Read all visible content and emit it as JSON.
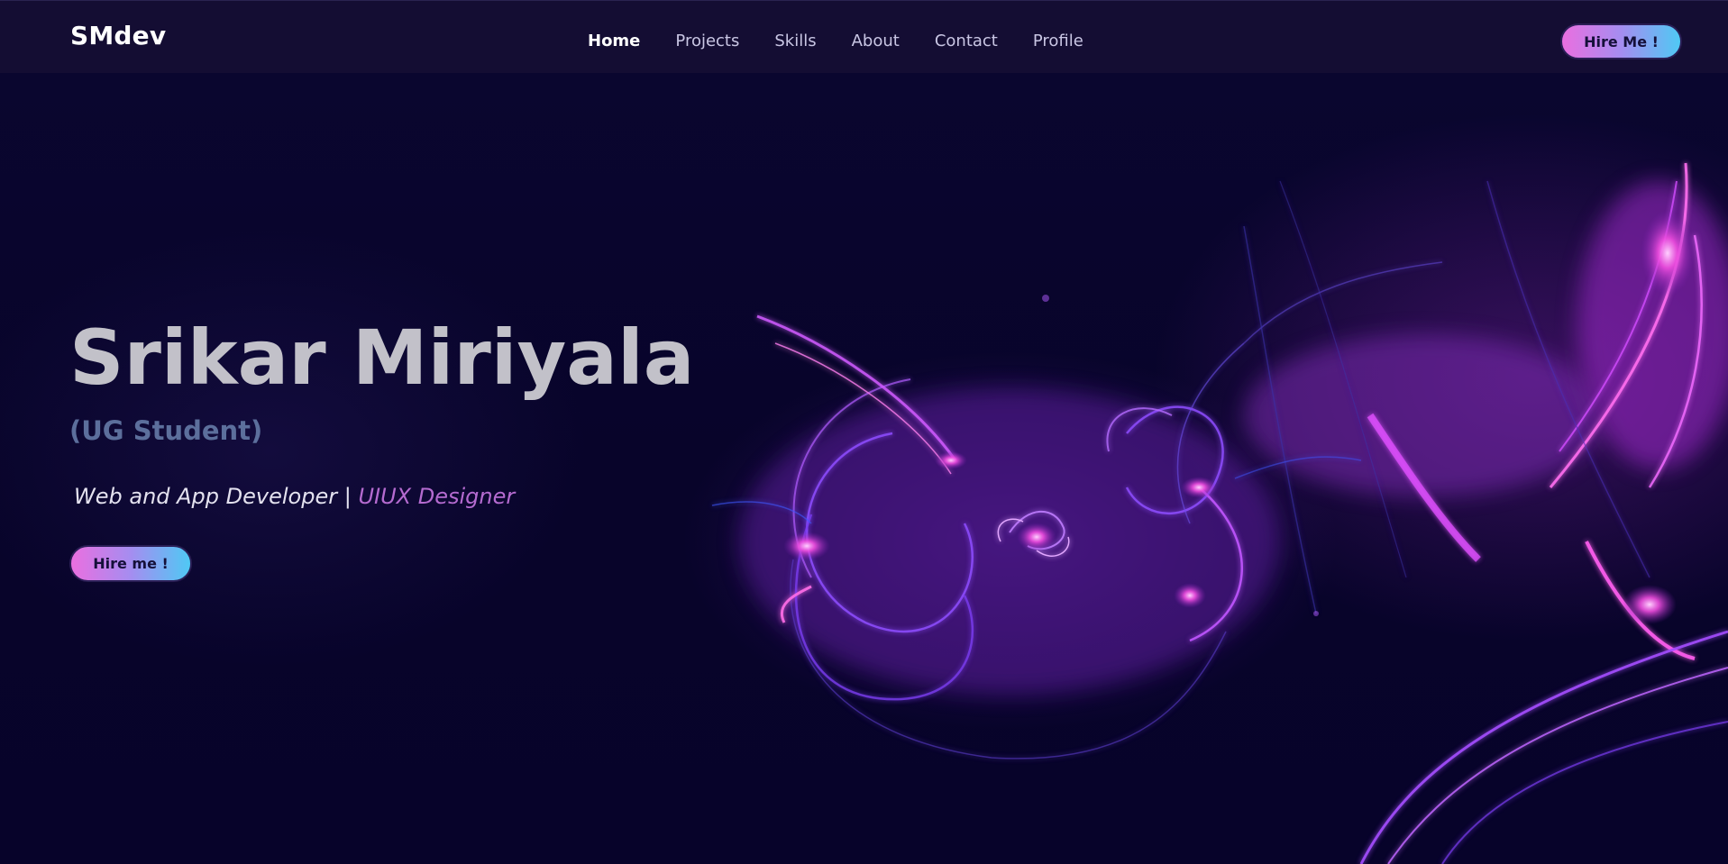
{
  "nav": {
    "logo": "SMdev",
    "links": [
      {
        "label": "Home",
        "active": true
      },
      {
        "label": "Projects",
        "active": false
      },
      {
        "label": "Skills",
        "active": false
      },
      {
        "label": "About",
        "active": false
      },
      {
        "label": "Contact",
        "active": false
      },
      {
        "label": "Profile",
        "active": false
      }
    ],
    "cta_label": "Hire Me !"
  },
  "hero": {
    "name": "Srikar Miriyala",
    "subtitle": "(UG Student)",
    "role_primary": "Web and App Developer |",
    "role_secondary": "UIUX Designer",
    "cta_label": "Hire me !"
  },
  "colors": {
    "background": "#07042a",
    "navbar": "#140d33",
    "accent_pink": "#ea6fe0",
    "accent_blue": "#4fc9f4",
    "glow_purple": "#b23cf0",
    "glow_magenta": "#f04ee0"
  }
}
